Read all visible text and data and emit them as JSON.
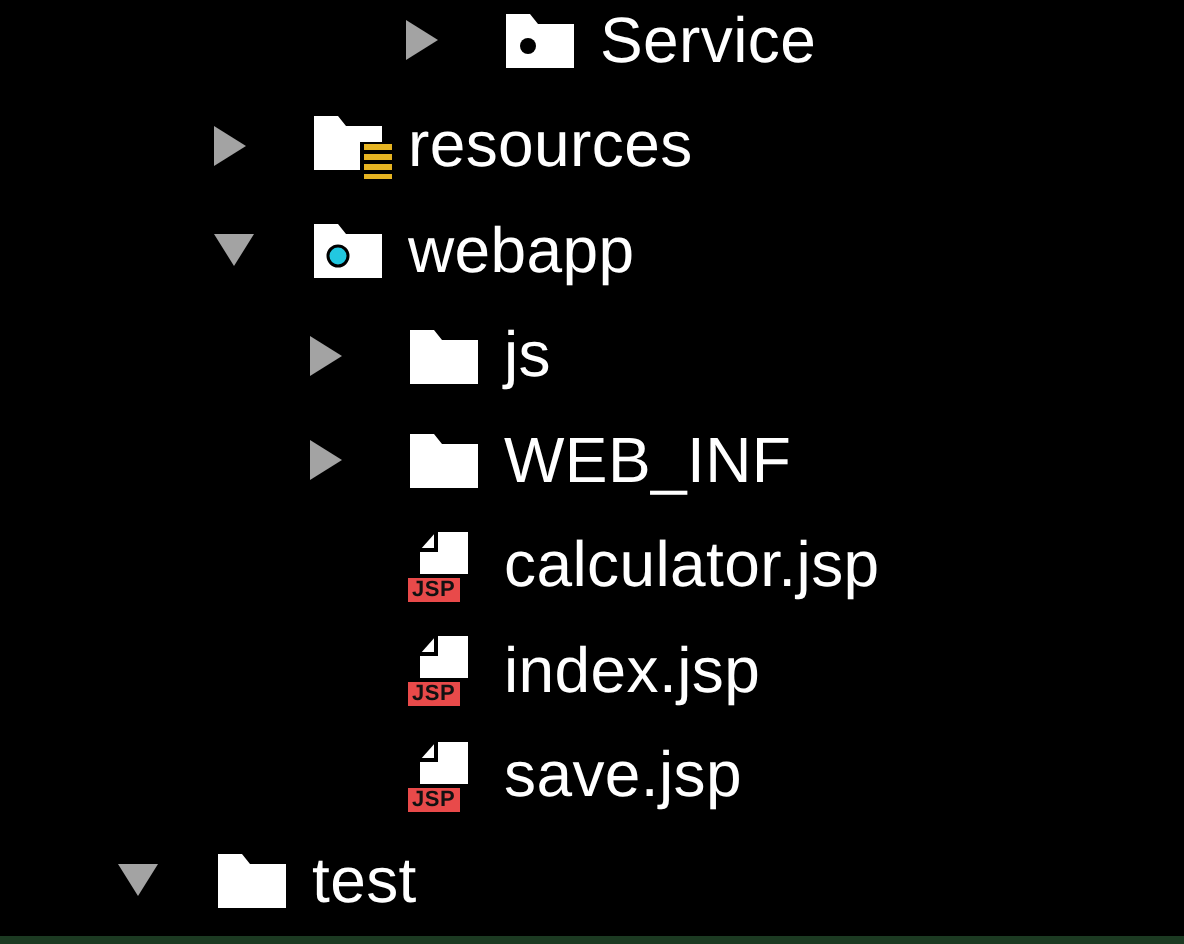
{
  "tree": {
    "items": [
      {
        "kind": "offscreen",
        "children": [
          {
            "kind": "offscreen",
            "children": [
              {
                "kind": "offscreen",
                "children": [
                  {
                    "kind": "package",
                    "label": "Service",
                    "expanded": false
                  }
                ]
              }
            ]
          },
          {
            "kind": "resources",
            "label": "resources",
            "expanded": false
          },
          {
            "kind": "web",
            "label": "webapp",
            "expanded": true,
            "children": [
              {
                "kind": "folder",
                "label": "js",
                "expanded": false
              },
              {
                "kind": "folder",
                "label": "WEB_INF",
                "expanded": false
              },
              {
                "kind": "jsp",
                "label": "calculator.jsp",
                "badge": "JSP"
              },
              {
                "kind": "jsp",
                "label": "index.jsp",
                "badge": "JSP"
              },
              {
                "kind": "jsp",
                "label": "save.jsp",
                "badge": "JSP"
              }
            ]
          }
        ]
      },
      {
        "kind": "folder",
        "label": "test",
        "expanded": true
      }
    ]
  }
}
